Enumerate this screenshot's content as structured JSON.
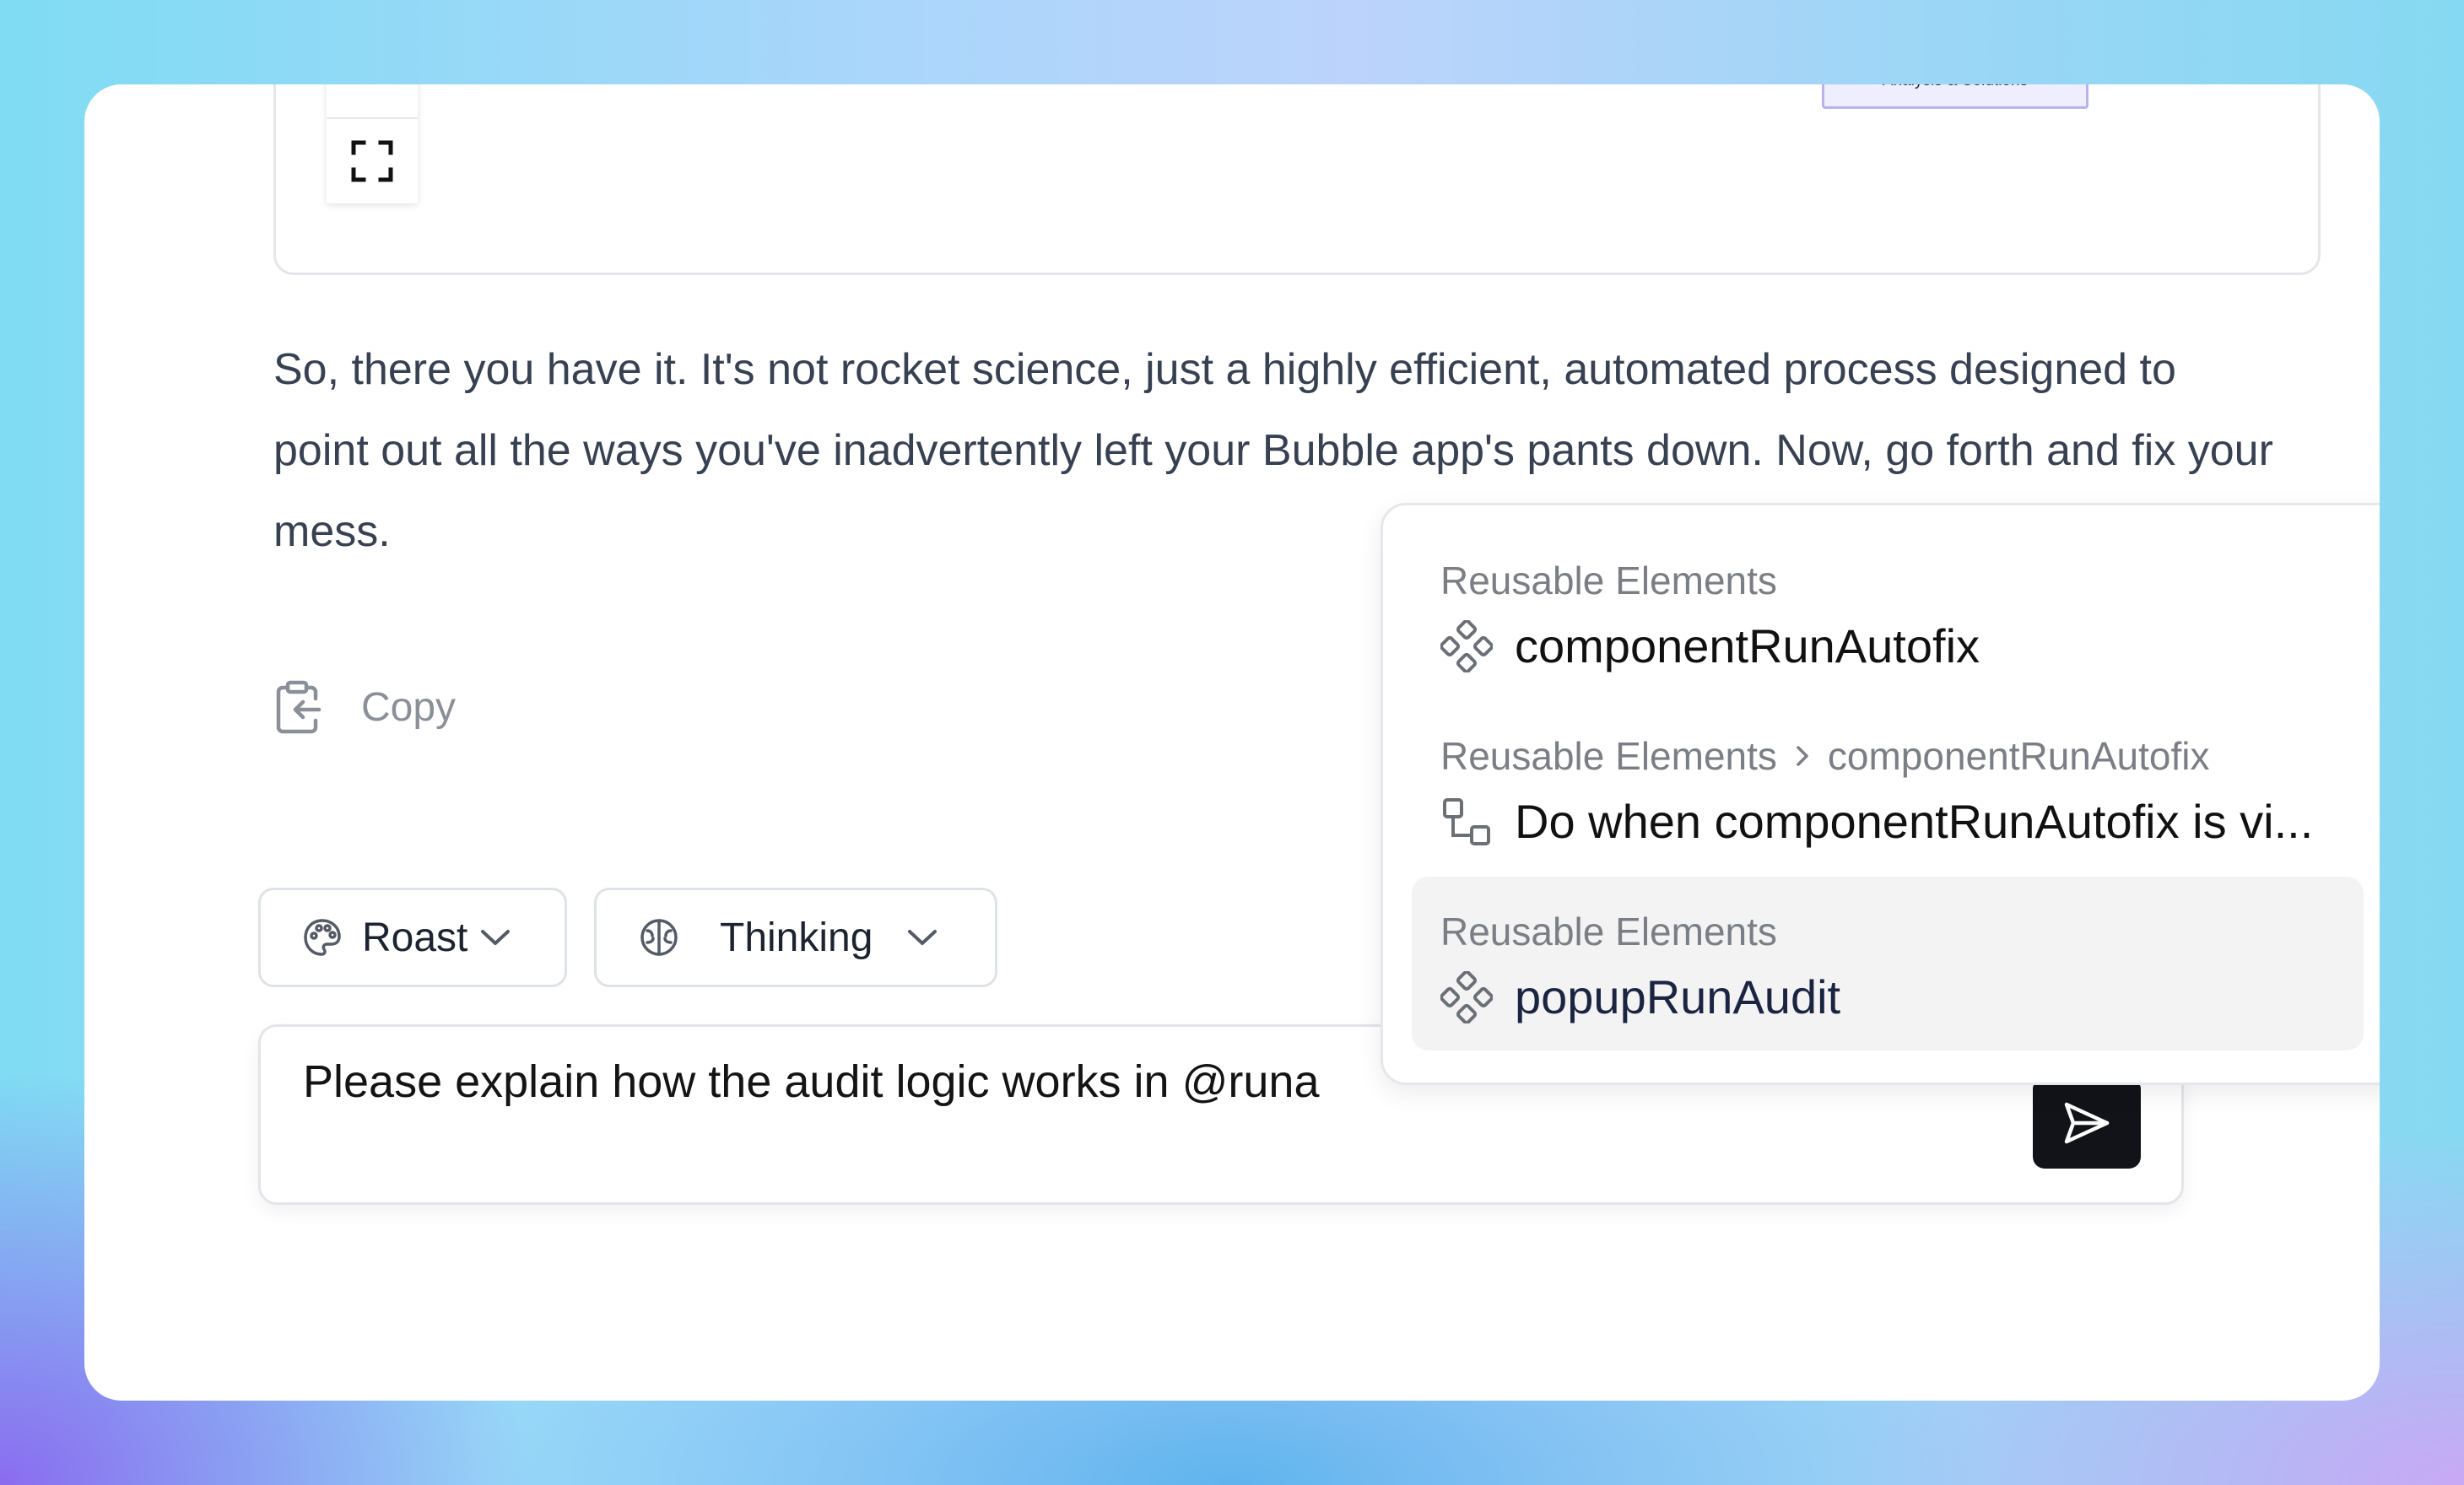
{
  "diagram": {
    "node_label": "Provide Vulnerability\nAnalysis & Solutions",
    "fit_icon": "fullscreen-icon"
  },
  "message": {
    "text": "So, there you have it. It's not rocket science, just a highly efficient, automated process designed to point out all the ways you've inadvertently left your Bubble app's pants down. Now, go forth and fix your mess.",
    "copy_label": "Copy",
    "copy_icon": "clipboard-icon"
  },
  "controls": {
    "style_chip": {
      "label": "Roast",
      "icon": "palette-icon"
    },
    "mode_chip": {
      "label": "Thinking",
      "icon": "brain-icon"
    }
  },
  "composer": {
    "value": "Please explain how the audit logic works in @runa",
    "send_icon": "send-icon"
  },
  "mentions": {
    "items": [
      {
        "crumb": [
          "Reusable Elements"
        ],
        "name": "componentRunAutofix",
        "icon": "component-icon",
        "selected": false
      },
      {
        "crumb": [
          "Reusable Elements",
          "componentRunAutofix"
        ],
        "name": "Do when componentRunAutofix is vi...",
        "icon": "workflow-icon",
        "selected": false
      },
      {
        "crumb": [
          "Reusable Elements"
        ],
        "name": "popupRunAudit",
        "icon": "component-icon",
        "selected": true
      }
    ]
  },
  "colors": {
    "panel": "#ffffff",
    "text": "#384152",
    "muted": "#7b7e85",
    "send_button": "#111318",
    "selected_row": "#f3f3f4",
    "node_fill": "#eeeefe",
    "node_border": "#b9b2ef"
  }
}
